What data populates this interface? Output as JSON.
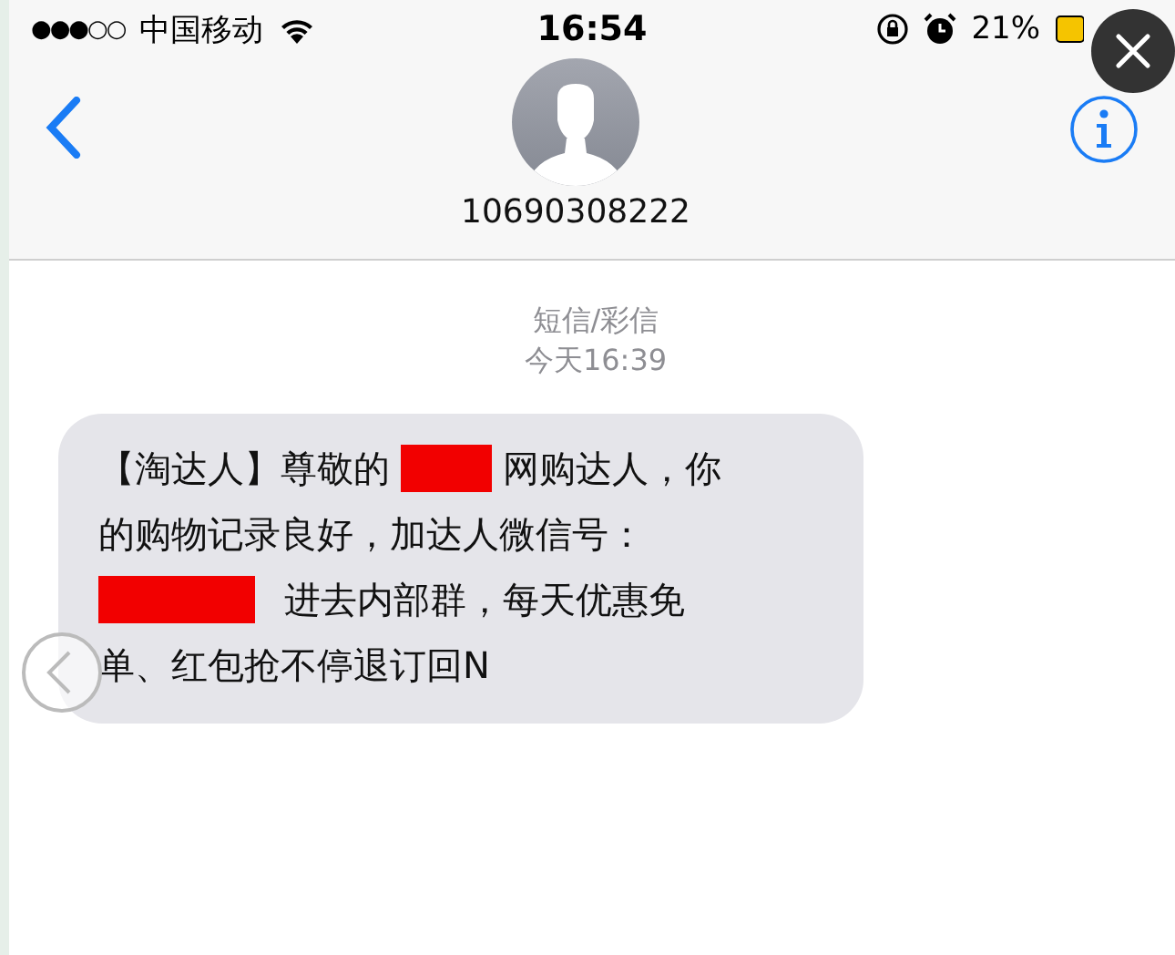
{
  "status_bar": {
    "signal_dots": "●●●○○",
    "carrier": "中国移动",
    "time": "16:54",
    "battery": "21%"
  },
  "header": {
    "contact": "10690308222"
  },
  "conversation": {
    "type": "短信/彩信",
    "timestamp": "今天16:39",
    "message": {
      "lines": [
        [
          {
            "kind": "text",
            "text": "【淘达人】尊敬的"
          },
          {
            "kind": "redaction"
          },
          {
            "kind": "text",
            "text": "网购达人，你"
          }
        ],
        [
          {
            "kind": "text",
            "text": "的购物记录良好，加达人微信号："
          }
        ],
        [
          {
            "kind": "redaction"
          },
          {
            "kind": "text",
            "text": "进去内部群，每天优惠免"
          }
        ],
        [
          {
            "kind": "text",
            "text": "单、红包抢不停退订回N"
          }
        ]
      ]
    }
  }
}
